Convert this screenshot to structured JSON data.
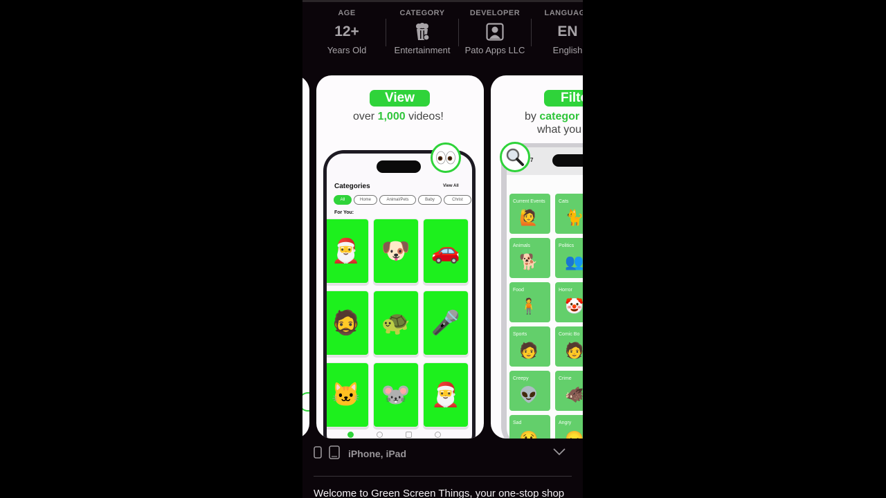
{
  "info": [
    {
      "label": "AGE",
      "value": "12+",
      "sub": "Years Old"
    },
    {
      "label": "CATEGORY",
      "icon": "popcorn-icon",
      "sub": "Entertainment"
    },
    {
      "label": "DEVELOPER",
      "icon": "person-icon",
      "sub": "Pato Apps LLC"
    },
    {
      "label": "LANGUAGE",
      "value": "EN",
      "sub": "English"
    }
  ],
  "screenshots": {
    "view": {
      "pill": "View",
      "tagline_pre": "over ",
      "tagline_hl": "1,000",
      "tagline_post": " videos!",
      "badge_icon": "eyes-icon",
      "app": {
        "title": "Categories",
        "view_all": "View All",
        "chips": [
          "All",
          "Home",
          "Animal/Pets",
          "Baby",
          "Christ"
        ],
        "active_chip": "All",
        "section": "For You:",
        "tiles": [
          "🎅",
          "🐶",
          "🚗",
          "🧔",
          "🐢",
          "🎤",
          "🐱",
          "🐭",
          "🎅"
        ]
      }
    },
    "filter": {
      "pill": "Filte",
      "tagline1_pre": "by ",
      "tagline1_hl": "categor",
      "tagline2": "what you",
      "badge_icon": "magnifier-icon",
      "status": "7",
      "categories": [
        {
          "name": "Current Events",
          "emoji": "🙋"
        },
        {
          "name": "Cats",
          "emoji": "🐈"
        },
        {
          "name": "Animals",
          "emoji": "🐕"
        },
        {
          "name": "Politics",
          "emoji": "👥"
        },
        {
          "name": "Food",
          "emoji": "🧍"
        },
        {
          "name": "Horror",
          "emoji": "🤡"
        },
        {
          "name": "Sports",
          "emoji": "🧑"
        },
        {
          "name": "Comic Bo",
          "emoji": "🧑"
        },
        {
          "name": "Creepy",
          "emoji": "👽"
        },
        {
          "name": "Crime",
          "emoji": "🐗"
        },
        {
          "name": "Sad",
          "emoji": "😢"
        },
        {
          "name": "Angry",
          "emoji": "😠"
        }
      ]
    }
  },
  "devices": {
    "label": "iPhone, iPad"
  },
  "description": "Welcome to Green Screen Things, your one-stop shop"
}
